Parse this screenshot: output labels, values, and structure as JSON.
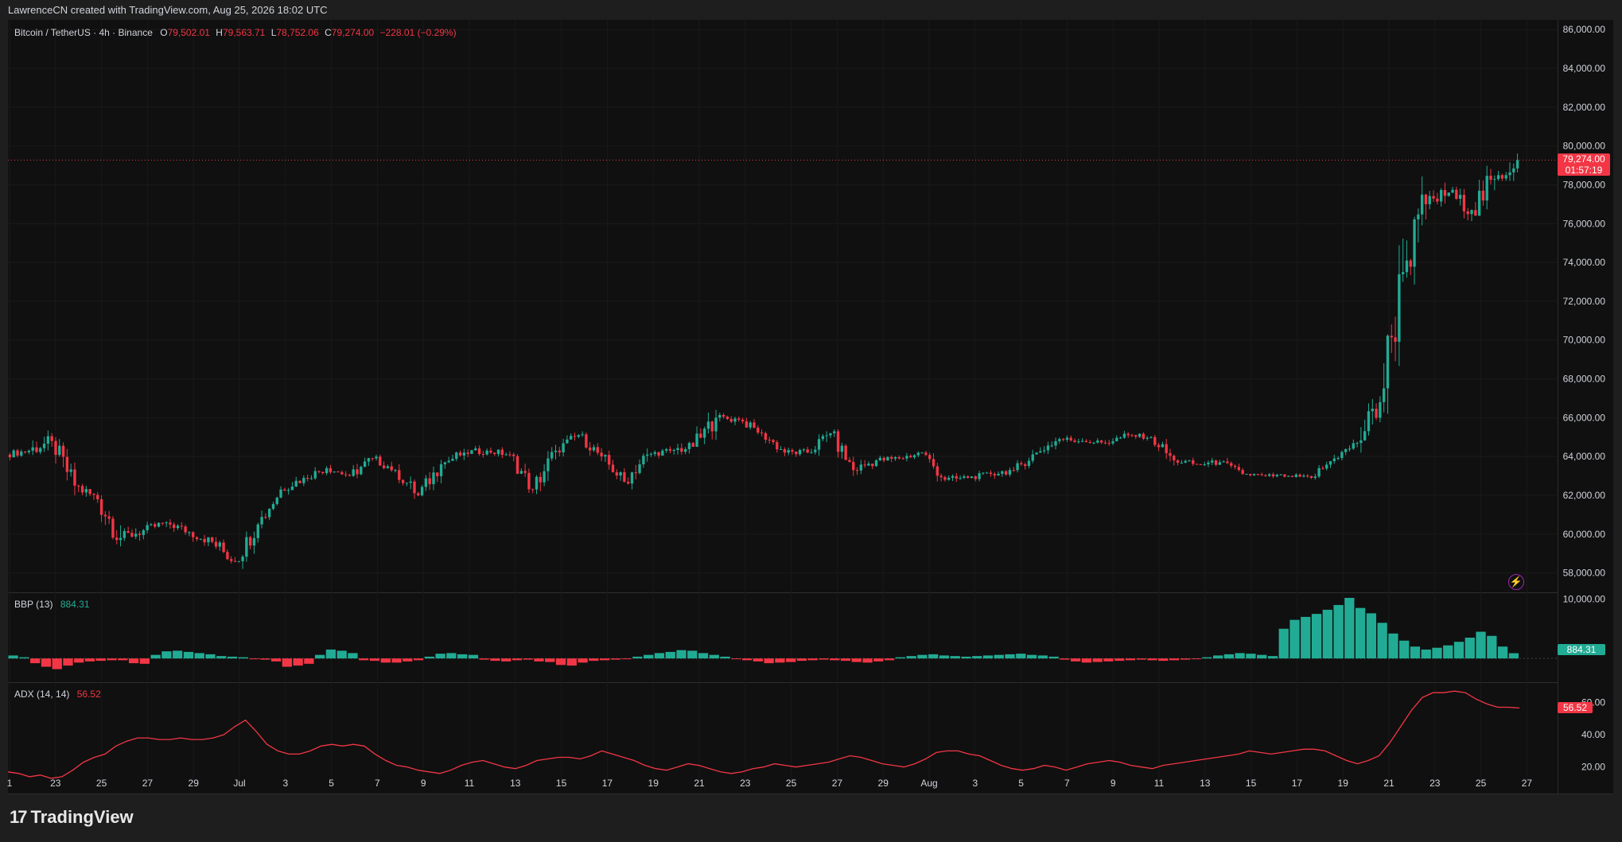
{
  "header": {
    "attribution": "LawrenceCN created with TradingView.com, Aug 25, 2026 18:02 UTC"
  },
  "main_legend": {
    "symbol": "Bitcoin / TetherUS · 4h · Binance",
    "o_label": "O",
    "o_value": "79,502.01",
    "h_label": "H",
    "h_value": "79,563.71",
    "l_label": "L",
    "l_value": "78,752.06",
    "c_label": "C",
    "c_value": "79,274.00",
    "change": "−228.01 (−0.29%)"
  },
  "price_tag": {
    "price": "79,274.00",
    "countdown": "01:57:19"
  },
  "bbp_legend": {
    "name": "BBP (13)",
    "value": "884.31"
  },
  "adx_legend": {
    "name": "ADX (14, 14)",
    "value": "56.52"
  },
  "brand": {
    "name": "TradingView"
  },
  "colors": {
    "up": "#22ab94",
    "down": "#f23645",
    "background": "#101010",
    "adx_line": "#f23645"
  },
  "chart_data": [
    {
      "type": "candlestick",
      "title": "Bitcoin / TetherUS · 4h · Binance",
      "ylim": [
        57000,
        86500
      ],
      "y_ticks": [
        "86,000.00",
        "84,000.00",
        "82,000.00",
        "80,000.00",
        "78,000.00",
        "76,000.00",
        "74,000.00",
        "72,000.00",
        "70,000.00",
        "68,000.00",
        "66,000.00",
        "64,000.00",
        "62,000.00",
        "60,000.00",
        "58,000.00"
      ],
      "x_ticks": [
        "1",
        "23",
        "25",
        "27",
        "29",
        "Jul",
        "3",
        "5",
        "7",
        "9",
        "11",
        "13",
        "15",
        "17",
        "19",
        "21",
        "23",
        "25",
        "27",
        "29",
        "Aug",
        "3",
        "5",
        "7",
        "9",
        "11",
        "13",
        "15",
        "17",
        "19",
        "21",
        "23",
        "25",
        "27"
      ],
      "last_price": 79274,
      "x": [
        "Jun 21",
        "Jun 22",
        "Jun 23",
        "Jun 24",
        "Jun 25",
        "Jun 26",
        "Jun 27",
        "Jun 28",
        "Jun 29",
        "Jun 30",
        "Jul 1",
        "Jul 2",
        "Jul 3",
        "Jul 4",
        "Jul 5",
        "Jul 6",
        "Jul 7",
        "Jul 8",
        "Jul 9",
        "Jul 10",
        "Jul 11",
        "Jul 12",
        "Jul 13",
        "Jul 14",
        "Jul 15",
        "Jul 16",
        "Jul 17",
        "Jul 18",
        "Jul 19",
        "Jul 20",
        "Jul 21",
        "Jul 22",
        "Jul 23",
        "Jul 24",
        "Jul 25",
        "Jul 26",
        "Jul 27",
        "Jul 28",
        "Jul 29",
        "Jul 30",
        "Jul 31",
        "Aug 1",
        "Aug 2",
        "Aug 3",
        "Aug 4",
        "Aug 5",
        "Aug 6",
        "Aug 7",
        "Aug 8",
        "Aug 9",
        "Aug 10",
        "Aug 11",
        "Aug 12",
        "Aug 13",
        "Aug 14",
        "Aug 15",
        "Aug 16",
        "Aug 17",
        "Aug 18",
        "Aug 19",
        "Aug 20",
        "Aug 21",
        "Aug 22",
        "Aug 23",
        "Aug 24",
        "Aug 25"
      ],
      "close": [
        64300,
        64800,
        62500,
        61800,
        59800,
        60200,
        60600,
        60100,
        59600,
        58600,
        60500,
        62300,
        62900,
        63400,
        63000,
        63900,
        63300,
        62000,
        63600,
        64200,
        64300,
        64100,
        62300,
        64300,
        65100,
        64000,
        62700,
        64100,
        64300,
        64500,
        66000,
        65900,
        65200,
        64200,
        64200,
        65200,
        63300,
        63800,
        63900,
        64200,
        62800,
        62900,
        63100,
        63300,
        64200,
        64900,
        64800,
        64700,
        65100,
        65000,
        63800,
        63600,
        63700,
        63100,
        63000,
        63000,
        62900,
        63900,
        64700,
        66800,
        73500,
        77000,
        77600,
        76700,
        78300,
        79274
      ],
      "open": [
        64100,
        64300,
        64800,
        62500,
        61800,
        59800,
        60200,
        60600,
        60100,
        59600,
        58600,
        60500,
        62300,
        62900,
        63400,
        63000,
        63900,
        63300,
        62000,
        63600,
        64200,
        64300,
        64100,
        62300,
        64300,
        65100,
        64000,
        62700,
        64100,
        64300,
        64500,
        66000,
        65900,
        65200,
        64200,
        64200,
        65200,
        63300,
        63800,
        63900,
        64200,
        62800,
        62900,
        63100,
        63300,
        64200,
        64900,
        64800,
        64700,
        65100,
        65000,
        63800,
        63600,
        63700,
        63100,
        63000,
        63000,
        62900,
        63900,
        64700,
        66800,
        73500,
        77000,
        77600,
        76700,
        78300
      ],
      "high": [
        64800,
        65600,
        65000,
        62900,
        62000,
        60800,
        61000,
        60900,
        60500,
        60300,
        60900,
        62800,
        63400,
        63900,
        63800,
        64400,
        64100,
        63600,
        64000,
        64600,
        64700,
        64600,
        64200,
        64600,
        65500,
        65300,
        64300,
        64500,
        64700,
        65200,
        66800,
        66400,
        66000,
        65400,
        64700,
        65800,
        65400,
        64300,
        64300,
        64600,
        64400,
        63400,
        63400,
        63800,
        64500,
        65300,
        65200,
        65100,
        65500,
        65400,
        65200,
        64200,
        64100,
        64000,
        63300,
        63300,
        63200,
        64200,
        65000,
        68500,
        76000,
        79500,
        78600,
        77900,
        80600,
        81200
      ],
      "low": [
        63800,
        63600,
        62000,
        61000,
        58300,
        59100,
        59800,
        59700,
        59100,
        58000,
        58200,
        60300,
        62000,
        62700,
        62800,
        62700,
        62800,
        61600,
        61800,
        63200,
        63700,
        63600,
        61900,
        61800,
        64000,
        63700,
        62400,
        62300,
        63800,
        63800,
        64200,
        65300,
        64800,
        64000,
        63700,
        64000,
        63000,
        62900,
        63300,
        63600,
        62500,
        62400,
        62600,
        62800,
        63100,
        64000,
        64300,
        64400,
        64500,
        64700,
        63500,
        63300,
        63300,
        62900,
        62700,
        62700,
        62600,
        62800,
        63800,
        64200,
        66200,
        72500,
        76300,
        75700,
        76400,
        78200
      ]
    },
    {
      "type": "bar",
      "title": "BBP (13)",
      "last_value": 884.31,
      "y_ticks": [
        "10,000.00"
      ],
      "ylim": [
        -4000,
        11000
      ],
      "values": [
        500,
        200,
        -800,
        -1400,
        -1800,
        -1200,
        -700,
        -500,
        -400,
        -300,
        -300,
        -800,
        -900,
        600,
        1200,
        1300,
        1100,
        900,
        700,
        400,
        300,
        200,
        -100,
        -200,
        -500,
        -1400,
        -1200,
        -900,
        600,
        1500,
        1300,
        900,
        -300,
        -400,
        -700,
        -700,
        -500,
        -300,
        300,
        800,
        900,
        700,
        600,
        -200,
        -400,
        -500,
        -300,
        -200,
        -500,
        -600,
        -1100,
        -1200,
        -700,
        -400,
        -300,
        -200,
        -100,
        300,
        600,
        900,
        1100,
        1400,
        1300,
        900,
        600,
        300,
        -100,
        -300,
        -500,
        -800,
        -700,
        -600,
        -400,
        -300,
        -200,
        -300,
        -400,
        -600,
        -700,
        -500,
        -300,
        200,
        400,
        600,
        700,
        500,
        400,
        300,
        400,
        500,
        600,
        700,
        800,
        600,
        500,
        300,
        -200,
        -500,
        -700,
        -600,
        -500,
        -400,
        -300,
        -200,
        -300,
        -400,
        -300,
        -200,
        -100,
        200,
        500,
        700,
        900,
        800,
        600,
        400,
        5000,
        6500,
        7000,
        7500,
        8200,
        9000,
        10200,
        8500,
        7600,
        6000,
        4200,
        3000,
        2000,
        1500,
        1800,
        2200,
        2800,
        3500,
        4500,
        3800,
        2000,
        884
      ]
    },
    {
      "type": "line",
      "title": "ADX (14, 14)",
      "last_value": 56.52,
      "y_ticks": [
        "60.00",
        "40.00",
        "20.00"
      ],
      "ylim": [
        10,
        72
      ],
      "values": [
        17,
        16,
        14,
        15,
        13,
        14,
        18,
        23,
        26,
        28,
        33,
        36,
        38,
        38,
        37,
        37,
        38,
        37,
        37,
        38,
        40,
        45,
        49,
        42,
        34,
        30,
        28,
        28,
        30,
        33,
        34,
        33,
        34,
        33,
        28,
        24,
        21,
        20,
        18,
        17,
        16,
        18,
        21,
        23,
        24,
        22,
        20,
        19,
        21,
        24,
        25,
        26,
        26,
        25,
        27,
        30,
        28,
        26,
        24,
        21,
        19,
        18,
        20,
        22,
        21,
        19,
        17,
        16,
        17,
        19,
        20,
        22,
        21,
        20,
        21,
        22,
        23,
        25,
        27,
        26,
        24,
        22,
        21,
        20,
        22,
        25,
        29,
        30,
        30,
        28,
        27,
        24,
        21,
        19,
        18,
        19,
        21,
        20,
        18,
        20,
        22,
        23,
        24,
        23,
        21,
        20,
        19,
        21,
        22,
        23,
        24,
        25,
        26,
        27,
        28,
        30,
        29,
        28,
        29,
        30,
        31,
        31,
        30,
        27,
        24,
        22,
        24,
        27,
        35,
        45,
        55,
        63,
        66,
        66,
        67,
        66,
        62,
        59,
        57,
        57,
        56.52
      ]
    }
  ]
}
